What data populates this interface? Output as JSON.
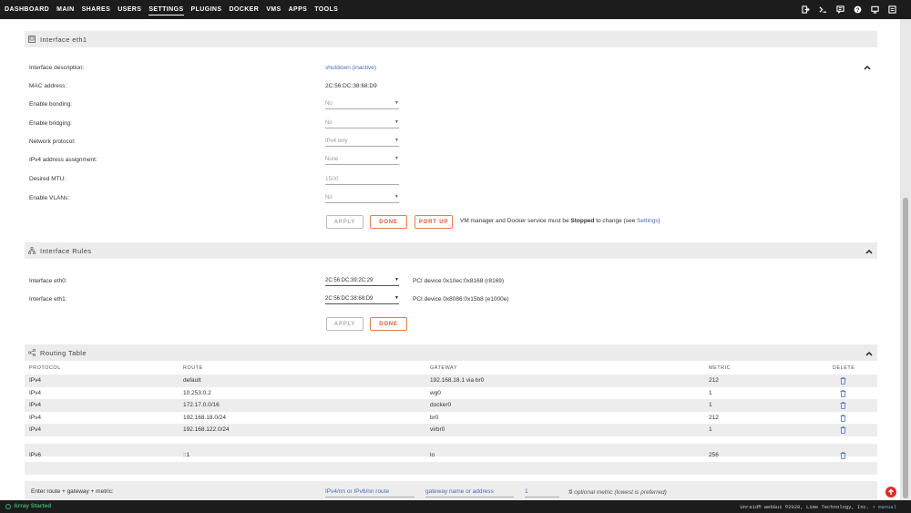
{
  "nav": {
    "items": [
      "DASHBOARD",
      "MAIN",
      "SHARES",
      "USERS",
      "SETTINGS",
      "PLUGINS",
      "DOCKER",
      "VMS",
      "APPS",
      "TOOLS"
    ],
    "active": "SETTINGS",
    "icons": [
      "logout-icon",
      "terminal-icon",
      "feedback-icon",
      "help-icon",
      "log-icon",
      "info-icon"
    ]
  },
  "interface_eth1": {
    "title": "Interface eth1",
    "rows": [
      {
        "label": "Interface description:",
        "value": "shutdown (inactive)"
      },
      {
        "label": "MAC address:",
        "value": "2C:56:DC:38:68:D9"
      },
      {
        "label": "Enable bonding:",
        "value": "No"
      },
      {
        "label": "Enable bridging:",
        "value": "No"
      },
      {
        "label": "Network protocol:",
        "value": "IPv4 only"
      },
      {
        "label": "IPv4 address assignment:",
        "value": "None"
      },
      {
        "label": "Desired MTU:",
        "value": "1500"
      },
      {
        "label": "Enable VLANs:",
        "value": "No"
      }
    ],
    "buttons": {
      "apply": "APPLY",
      "done": "DONE",
      "port_up": "PORT UP"
    },
    "note_prefix": "VM manager and Docker service must be ",
    "note_bold": "Stopped",
    "note_mid": " to change (see ",
    "note_link": "Settings",
    "note_suffix": ")"
  },
  "interface_rules": {
    "title": "Interface Rules",
    "rows": [
      {
        "label": "Interface eth0:",
        "mac": "2C:56:DC:39:2C:29",
        "device": "PCI device 0x10ec:0x8168 (r8169)"
      },
      {
        "label": "Interface eth1:",
        "mac": "2C:56:DC:38:68:D9",
        "device": "PCI device 0x8086:0x15b8 (e1000e)"
      }
    ],
    "buttons": {
      "apply": "APPLY",
      "done": "DONE"
    }
  },
  "routing_table": {
    "title": "Routing Table",
    "columns": [
      "PROTOCOL",
      "ROUTE",
      "GATEWAY",
      "METRIC",
      "DELETE"
    ],
    "rows": [
      {
        "protocol": "IPv4",
        "route": "default",
        "gateway": "192.168.18.1 via br0",
        "metric": "212"
      },
      {
        "protocol": "IPv4",
        "route": "10.253.0.2",
        "gateway": "wg0",
        "metric": "1"
      },
      {
        "protocol": "IPv4",
        "route": "172.17.0.0/16",
        "gateway": "docker0",
        "metric": "1"
      },
      {
        "protocol": "IPv4",
        "route": "192.168.18.0/24",
        "gateway": "br0",
        "metric": "212"
      },
      {
        "protocol": "IPv4",
        "route": "192.168.122.0/24",
        "gateway": "virbr0",
        "metric": "1"
      },
      {
        "protocol": "",
        "route": "",
        "gateway": "",
        "metric": ""
      },
      {
        "protocol": "IPv6",
        "route": "::1",
        "gateway": "lo",
        "metric": "256"
      }
    ],
    "add_label": "Enter route + gateway + metric:",
    "route_placeholder": "IPv4/nn or IPv6/nn route",
    "gateway_placeholder": "gateway name or address",
    "metric_value": "1",
    "metric_hint": "optional metric (lowest is preferred)"
  },
  "footer": {
    "status": "Array Started",
    "copyright": "Unraid® webGui ©2020, Lime Technology, Inc.",
    "manual": "manual"
  },
  "colors": {
    "accent": "#e5532a",
    "link": "#486dba",
    "status_green": "#3bb36a",
    "nav_bg": "#1c1c1c"
  }
}
